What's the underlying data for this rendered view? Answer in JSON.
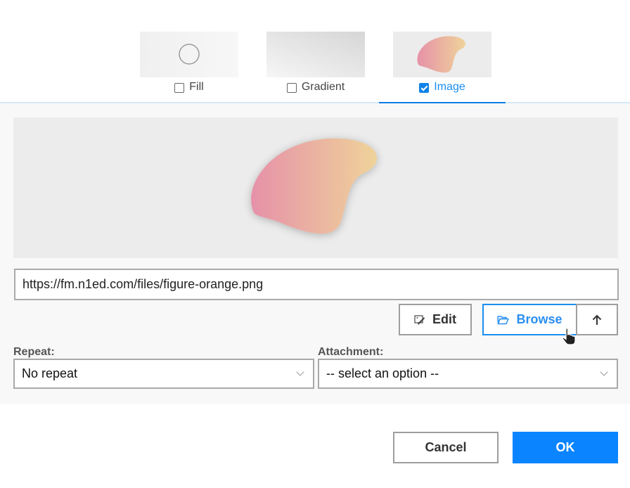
{
  "tabs": [
    {
      "label": "Fill",
      "checked": false
    },
    {
      "label": "Gradient",
      "checked": false
    },
    {
      "label": "Image",
      "checked": true
    }
  ],
  "image": {
    "url": "https://fm.n1ed.com/files/figure-orange.png",
    "url_placeholder": ""
  },
  "buttons": {
    "edit": "Edit",
    "browse": "Browse",
    "cancel": "Cancel",
    "ok": "OK"
  },
  "repeat": {
    "label": "Repeat:",
    "value": "No repeat"
  },
  "attachment": {
    "label": "Attachment:",
    "value": "-- select an option --"
  },
  "colors": {
    "accent": "#0a84ff",
    "shape_start": "#e691a8",
    "shape_end": "#efd39a"
  }
}
